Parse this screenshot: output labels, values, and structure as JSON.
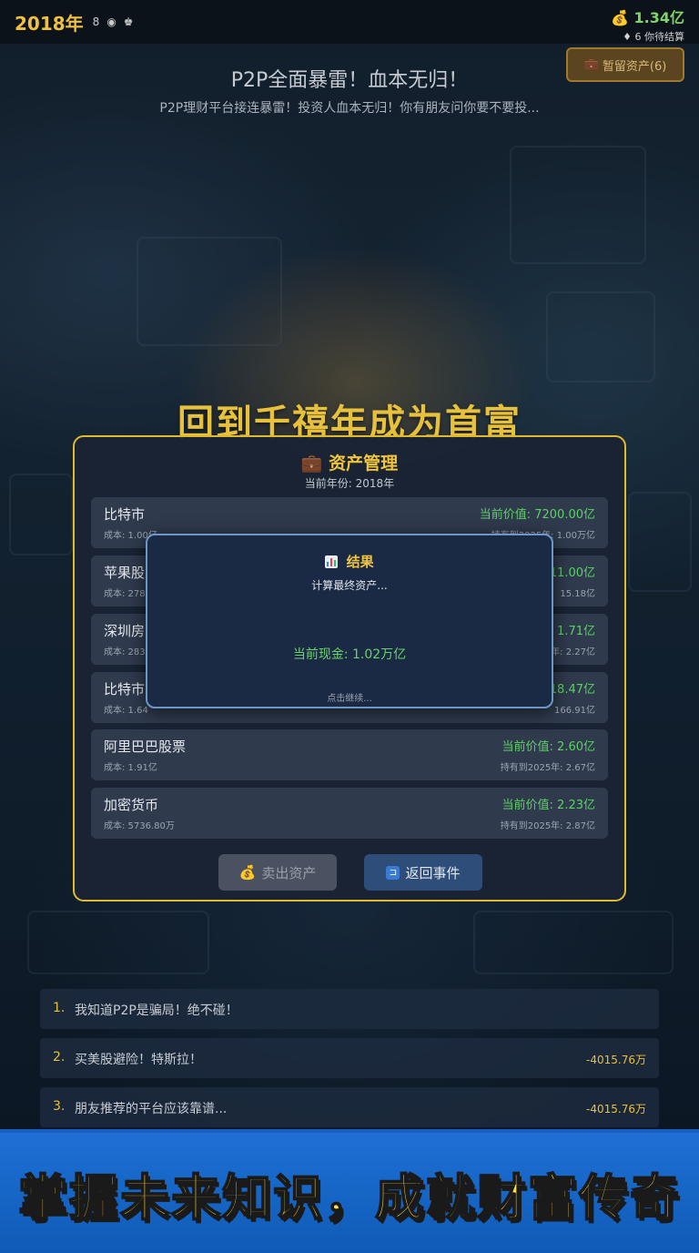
{
  "top_bar": {
    "year": "2018年",
    "icons": [
      "8",
      "◉",
      "♚"
    ],
    "money_icon": "💰",
    "money": "1.34亿",
    "pending_icon": "♦",
    "pending_count": "6",
    "pending_label": "你待结算"
  },
  "asset_button": {
    "icon": "💼",
    "label": "暂留资产(6)"
  },
  "event": {
    "title": "P2P全面暴雷！血本无归！",
    "description": "P2P理财平台接连暴雷！投资人血本无归！你有朋友问你要不要投..."
  },
  "main_title": "回到千禧年成为首富",
  "asset_panel": {
    "title_icon": "💼",
    "title": "资产管理",
    "subtitle": "当前年份: 2018年",
    "assets": [
      {
        "name": "比特市",
        "cost": "成本: 1.00亿",
        "value": "当前价值: 7200.00亿",
        "hold": "持有到2025年: 1.00万亿"
      },
      {
        "name": "苹果股",
        "cost": "成本: 278",
        "value": "11.00亿",
        "hold": "15.18亿"
      },
      {
        "name": "深圳房",
        "cost": "成本: 283",
        "value": "值: 1.71亿",
        "hold": "年: 2.27亿"
      },
      {
        "name": "比特市",
        "cost": "成本: 1.64",
        "value": "18.47亿",
        "hold": "166.91亿"
      },
      {
        "name": "阿里巴巴股票",
        "cost": "成本: 1.91亿",
        "value": "当前价值: 2.60亿",
        "hold": "持有到2025年: 2.67亿"
      },
      {
        "name": "加密货币",
        "cost": "成本: 5736.80万",
        "value": "当前价值: 2.23亿",
        "hold": "持有到2025年: 2.87亿"
      }
    ],
    "sell_icon": "💰",
    "sell_label": "卖出资产",
    "back_icon": "⊐",
    "back_label": "返回事件"
  },
  "result_modal": {
    "title": "结果",
    "subtitle": "计算最终资产...",
    "cash": "当前现金: 1.02万亿",
    "hint": "点击继续..."
  },
  "options": [
    {
      "num": "1.",
      "text": "我知道P2P是骗局！绝不碰！",
      "delta": ""
    },
    {
      "num": "2.",
      "text": "买美股避险！特斯拉！",
      "delta": "-4015.76万"
    },
    {
      "num": "3.",
      "text": "朋友推荐的平台应该靠谱...",
      "delta": "-4015.76万"
    }
  ],
  "banner": "掌握未来知识，成就财富传奇",
  "colors": {
    "gold": "#e8c13c",
    "green": "#5fd068",
    "panel_border": "#e1b92e",
    "banner_blue": "#1666c6"
  }
}
